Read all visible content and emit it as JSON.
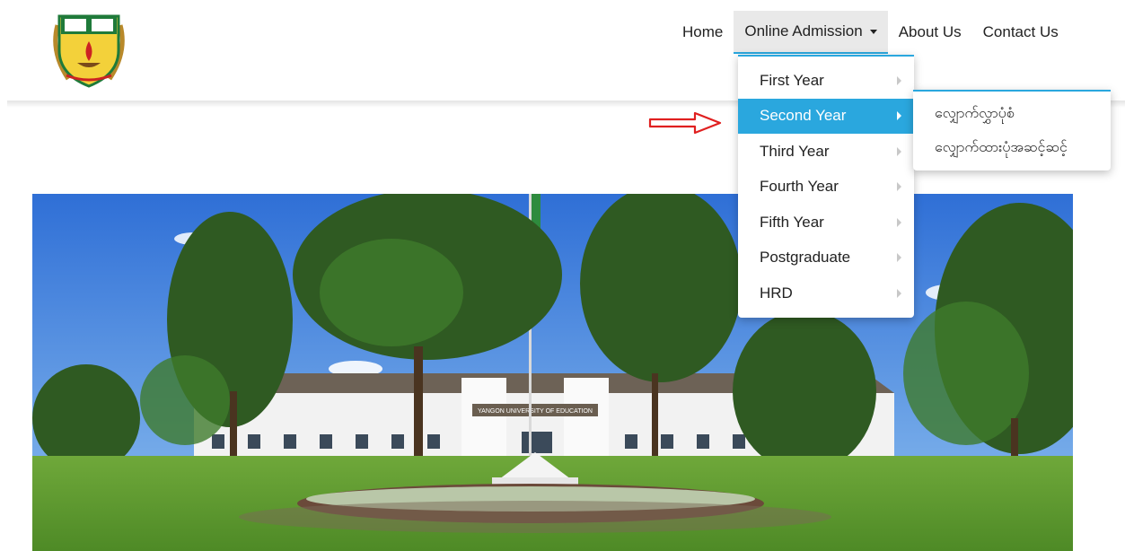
{
  "nav": {
    "home": "Home",
    "online_admission": "Online Admission",
    "about": "About Us",
    "contact": "Contact Us"
  },
  "dropdown": {
    "items": [
      {
        "label": "First Year"
      },
      {
        "label": "Second Year",
        "active": true
      },
      {
        "label": "Third Year"
      },
      {
        "label": "Fourth Year"
      },
      {
        "label": "Fifth Year"
      },
      {
        "label": "Postgraduate"
      },
      {
        "label": "HRD"
      }
    ]
  },
  "submenu": {
    "items": [
      {
        "label": "လျှောက်လွှာပုံစံ"
      },
      {
        "label": "လျှောက်ထားပုံအဆင့်ဆင့်"
      }
    ]
  },
  "hero": {
    "building_sign": "YANGON UNIVERSITY OF EDUCATION"
  },
  "colors": {
    "accent": "#2aa7de",
    "arrow": "#e02020",
    "logo_yellow": "#f3d13a",
    "logo_green": "#1f7a3a",
    "logo_red": "#cc2222"
  },
  "icons": {
    "caret": "chevron-down-icon",
    "submenu_arrow": "chevron-right-icon",
    "pointer": "right-arrow-icon"
  }
}
